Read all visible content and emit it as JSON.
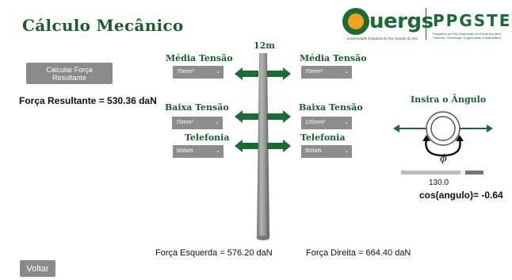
{
  "header": {
    "title": "Cálculo Mecânico",
    "logo_text": "uergs",
    "logo_subtitle": "Universidade Estadual do Rio Grande do Sul",
    "program_name": "PPGSTEM",
    "program_subtitle": "Programa de Pós-Graduação em Docência para Ciências, Tecnologia, Engenharias e Matemática"
  },
  "controls": {
    "calculate_label": "Calcular Força Resultante",
    "result_label": "Força Resultante = 530.36 daN",
    "back_label": "Voltar"
  },
  "pole": {
    "height_label": "12m"
  },
  "left": {
    "media_tensao_label": "Média Tensão",
    "media_tensao_value": "70mm²",
    "baixa_tensao_label": "Baixa Tensão",
    "baixa_tensao_value": "70mm²",
    "telefonia_label": "Telefonia",
    "telefonia_value": "90daN"
  },
  "right": {
    "media_tensao_label": "Média Tensão",
    "media_tensao_value": "70mm²",
    "baixa_tensao_label": "Baixa Tensão",
    "baixa_tensao_value": "120mm²",
    "telefonia_label": "Telefonia",
    "telefonia_value": "90daN"
  },
  "forces": {
    "left_label": "Força Esquerda = 576.20 daN",
    "right_label": "Força Direita = 664.40 daN"
  },
  "angle": {
    "title": "Insira o Ângulo",
    "symbol": "ϕ",
    "slider_value": "130.0",
    "slider_fraction": 0.72,
    "cos_label": "cos(angulo)= -0.64"
  },
  "colors": {
    "accent_green": "#1b6b34",
    "logo_orange": "#f2a31b",
    "control_gray": "#8d8d8d"
  },
  "icons": {
    "arrow": "double-arrow-icon",
    "pole": "pole-icon",
    "angle_diagram": "angle-diagram-icon"
  }
}
